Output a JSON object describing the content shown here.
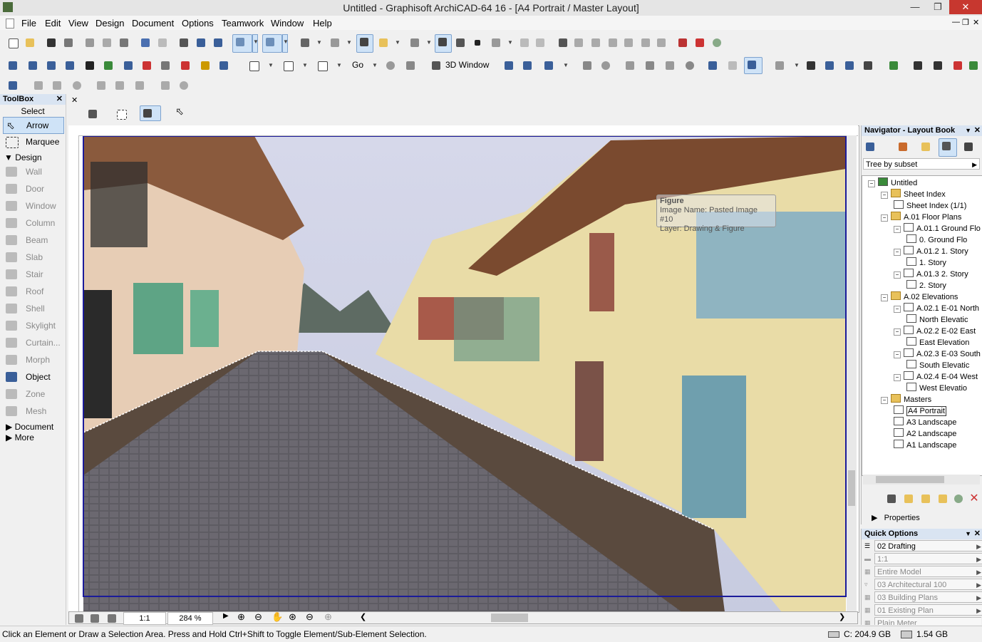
{
  "window": {
    "title": "Untitled - Graphisoft ArchiCAD-64 16 - [A4 Portrait / Master Layout]"
  },
  "menu": [
    "File",
    "Edit",
    "View",
    "Design",
    "Document",
    "Options",
    "Teamwork",
    "Window",
    "Help"
  ],
  "toolbar": {
    "three_d_window": "3D Window",
    "go": "Go"
  },
  "toolbox": {
    "title": "ToolBox",
    "select_label": "Select",
    "arrow": "Arrow",
    "marquee": "Marquee",
    "design_label": "Design",
    "tools": [
      "Wall",
      "Door",
      "Window",
      "Column",
      "Beam",
      "Slab",
      "Stair",
      "Roof",
      "Shell",
      "Skylight",
      "Curtain...",
      "Morph",
      "Object",
      "Zone",
      "Mesh"
    ],
    "document": "Document",
    "more": "More"
  },
  "tooltip": {
    "title": "Figure",
    "line1": "Image Name: Pasted Image #10",
    "line2": "Layer: Drawing & Figure"
  },
  "bottombar": {
    "scale": "1:1",
    "zoom": "284 %"
  },
  "navigator": {
    "title": "Navigator - Layout Book",
    "view_mode": "Tree by subset",
    "tree": [
      {
        "label": "Untitled",
        "level": 0
      },
      {
        "label": "Sheet Index",
        "level": 1
      },
      {
        "label": "Sheet Index (1/1)",
        "level": 2
      },
      {
        "label": "A.01 Floor Plans",
        "level": 1
      },
      {
        "label": "A.01.1 Ground Flo",
        "level": 2
      },
      {
        "label": "0. Ground Flo",
        "level": 3
      },
      {
        "label": "A.01.2 1. Story",
        "level": 2
      },
      {
        "label": "1. Story",
        "level": 3
      },
      {
        "label": "A.01.3 2. Story",
        "level": 2
      },
      {
        "label": "2. Story",
        "level": 3
      },
      {
        "label": "A.02 Elevations",
        "level": 1
      },
      {
        "label": "A.02.1 E-01 North",
        "level": 2
      },
      {
        "label": "North Elevatic",
        "level": 3
      },
      {
        "label": "A.02.2 E-02 East",
        "level": 2
      },
      {
        "label": "East Elevation",
        "level": 3
      },
      {
        "label": "A.02.3 E-03 South",
        "level": 2
      },
      {
        "label": "South Elevatic",
        "level": 3
      },
      {
        "label": "A.02.4 E-04 West",
        "level": 2
      },
      {
        "label": "West Elevatio",
        "level": 3
      },
      {
        "label": "Masters",
        "level": 1
      },
      {
        "label": "A4 Portrait",
        "level": 2
      },
      {
        "label": "A3 Landscape",
        "level": 2
      },
      {
        "label": "A2 Landscape",
        "level": 2
      },
      {
        "label": "A1 Landscape",
        "level": 2
      }
    ],
    "properties": "Properties"
  },
  "quick_options": {
    "title": "Quick Options",
    "rows": [
      "02 Drafting",
      "1:1",
      "Entire Model",
      "03 Architectural 100",
      "03 Building Plans",
      "01 Existing Plan",
      "Plain Meter"
    ]
  },
  "status": {
    "message": "Click an Element or Draw a Selection Area. Press and Hold Ctrl+Shift to Toggle Element/Sub-Element Selection.",
    "disk": "C: 204.9 GB",
    "memory": "1.54 GB"
  }
}
